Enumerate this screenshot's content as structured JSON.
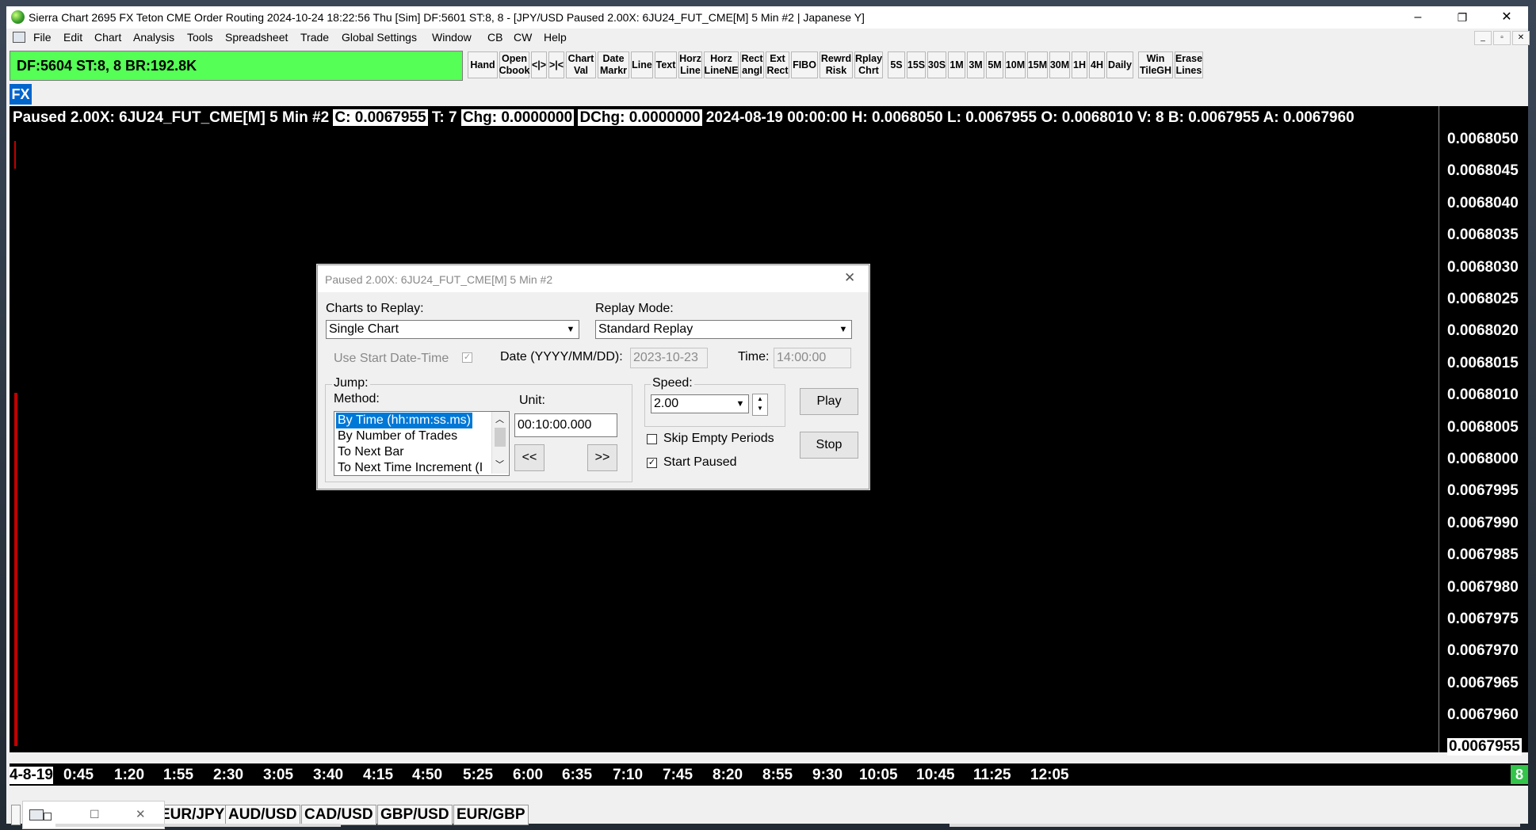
{
  "window": {
    "title": "Sierra Chart 2695 FX Teton CME Order Routing 2024-10-24  18:22:56 Thu [Sim] DF:5601  ST:8, 8 - [JPY/USD Paused 2.00X: 6JU24_FUT_CME[M]  5 Min  #2 | Japanese Y]",
    "min": "–",
    "max": "❐",
    "close": "✕"
  },
  "menu": [
    "File",
    "Edit",
    "Chart",
    "Analysis",
    "Tools",
    "Spreadsheet",
    "Trade",
    "Global Settings",
    "Window",
    "CB",
    "CW",
    "Help"
  ],
  "status": "DF:5604  ST:8, 8  BR:192.8K",
  "toolbar": [
    "Hand",
    "Open\nCbook",
    "<|>",
    ">|<",
    "Chart\nVal",
    "Date\nMarkr",
    "Line",
    "Text",
    "Horz\nLine",
    "Horz\nLineNE",
    "Rect\nangl",
    "Ext\nRect",
    "FIBO",
    "Rewrd\nRisk",
    "Rplay\nChrt",
    "5S",
    "15S",
    "30S",
    "1M",
    "3M",
    "5M",
    "10M",
    "15M",
    "30M",
    "1H",
    "4H",
    "Daily",
    "Win\nTileGH",
    "Erase\nLines"
  ],
  "fx_badge": "FX",
  "info": {
    "prefix": "Paused 2.00X: 6JU24_FUT_CME[M]  5 Min  #2 ",
    "c": "C: 0.0067955",
    "t": " T: 7 ",
    "chg": "Chg: 0.0000000",
    "dchg": "DChg: 0.0000000",
    "rest": " 2024-08-19 00:00:00 H: 0.0068050 L: 0.0067955 O: 0.0068010 V: 8 B: 0.0067955 A: 0.0067960"
  },
  "price_labels": [
    "0.0068050",
    "0.0068045",
    "0.0068040",
    "0.0068035",
    "0.0068030",
    "0.0068025",
    "0.0068020",
    "0.0068015",
    "0.0068010",
    "0.0068005",
    "0.0068000",
    "0.0067995",
    "0.0067990",
    "0.0067985",
    "0.0067980",
    "0.0067975",
    "0.0067970",
    "0.0067965",
    "0.0067960"
  ],
  "price_current": "0.0067955",
  "time_first": "4-8-19",
  "time_labels": [
    "0:45",
    "1:20",
    "1:55",
    "2:30",
    "3:05",
    "3:40",
    "4:15",
    "4:50",
    "5:25",
    "6:00",
    "6:35",
    "7:10",
    "7:45",
    "8:20",
    "8:55",
    "9:30",
    "10:05",
    "10:45",
    "11:25",
    "12:05"
  ],
  "bar_count": "8",
  "tabs": [
    "EUR/JPY",
    "AUD/USD",
    "CAD/USD",
    "GBP/USD",
    "EUR/GBP"
  ],
  "dialog": {
    "title": "Paused 2.00X: 6JU24_FUT_CME[M]  5 Min  #2",
    "charts_label": "Charts to Replay:",
    "charts_value": "Single Chart",
    "mode_label": "Replay Mode:",
    "mode_value": "Standard Replay",
    "use_start": "Use Start Date-Time",
    "date_label": "Date (YYYY/MM/DD):",
    "date_value": "2023-10-23",
    "time_label": "Time:",
    "time_value": "14:00:00",
    "jump_label": "Jump:",
    "method_label": "Method:",
    "methods": [
      "By Time (hh:mm:ss.ms)",
      "By Number of Trades",
      "To Next Bar",
      "To Next Time Increment (I"
    ],
    "unit_label": "Unit:",
    "unit_value": "00:10:00.000",
    "back_btn": "<<",
    "fwd_btn": ">>",
    "speed_label": "Speed:",
    "speed_value": "2.00",
    "skip_empty": "Skip Empty Periods",
    "start_paused": "Start Paused",
    "play": "Play",
    "stop": "Stop"
  }
}
